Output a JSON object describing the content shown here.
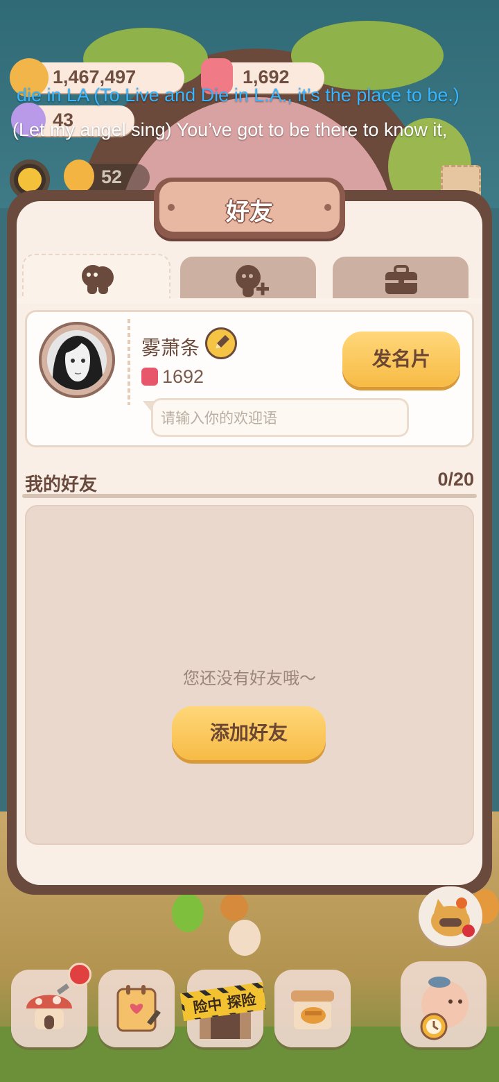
{
  "hud": {
    "coins": "1,467,497",
    "gems": "1,692",
    "third_currency": "43",
    "energy": "52"
  },
  "overlay_lyrics": {
    "line1": "die in LA (To Live and Die in L.A., it’s the place to be.)",
    "line2": "(Let my angel sing) You’ve got to be there to know it,"
  },
  "panel": {
    "title": "好友",
    "tabs": [
      {
        "icon": "friends-icon"
      },
      {
        "icon": "add-friend-icon"
      },
      {
        "icon": "briefcase-icon"
      }
    ]
  },
  "profile": {
    "name": "雾萧条",
    "score": "1692",
    "card_button": "发名片",
    "greeting_placeholder": "请输入你的欢迎语"
  },
  "friends": {
    "label": "我的好友",
    "count": "0/20",
    "empty_message": "您还没有好友哦～",
    "add_button": "添加好友"
  },
  "bottom_nav": {
    "explore_label": "险中 探险"
  },
  "colors": {
    "panel_bg": "#f9efe6",
    "frame": "#6b4a3e",
    "button_yellow": "#f7bb45",
    "text_brown": "#6a4a3c"
  }
}
